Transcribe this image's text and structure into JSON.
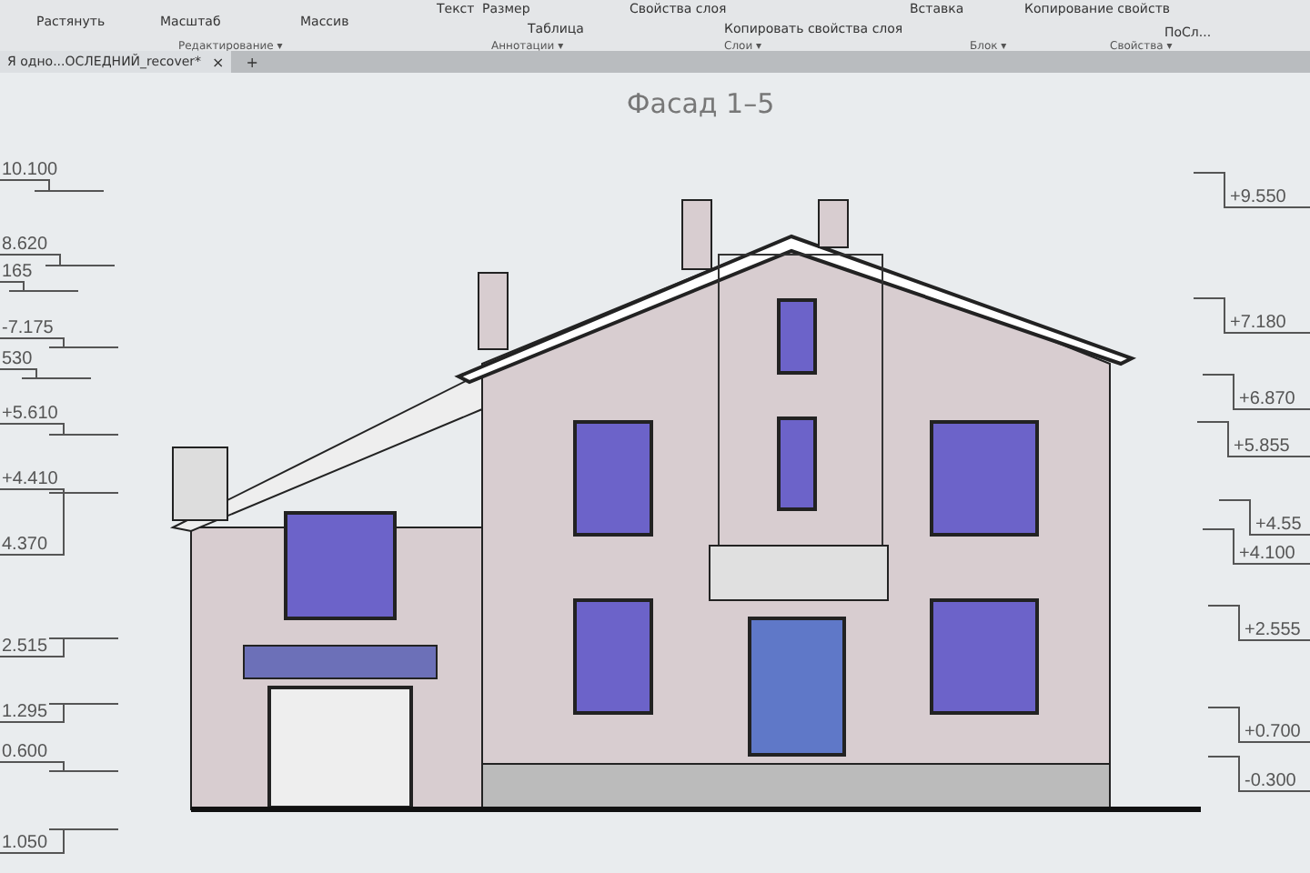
{
  "ribbon": {
    "tools": [
      {
        "label": "Растянуть"
      },
      {
        "label": "Масштаб"
      },
      {
        "label": "Массив"
      },
      {
        "label": "Текст"
      },
      {
        "label": "Размер"
      },
      {
        "label": "Таблица"
      },
      {
        "label": "Свойства слоя"
      },
      {
        "label": "Копировать свойства слоя"
      },
      {
        "label": "Вставка"
      },
      {
        "label": "Копирование свойств"
      },
      {
        "label": "ПоСл..."
      }
    ],
    "groups": [
      "Редактирование ▾",
      "Аннотации ▾",
      "Слои ▾",
      "Блок ▾",
      "Свойства ▾"
    ]
  },
  "document_tab": {
    "title": "Я одно...ОСЛЕДНИЙ_recover*",
    "close": "×",
    "add": "+"
  },
  "drawing": {
    "title": "Фасад 1–5",
    "left_levels": [
      "10.100",
      "8.620",
      "165",
      "-7.175",
      "530",
      "+5.610",
      "+4.410",
      "4.370",
      "2.515",
      "1.295",
      "0.600",
      "1.050"
    ],
    "right_levels": [
      "+9.550",
      "+7.180",
      "+6.870",
      "+5.855",
      "+4.55",
      "+4.100",
      "+2.555",
      "+0.700",
      "-0.300"
    ]
  }
}
